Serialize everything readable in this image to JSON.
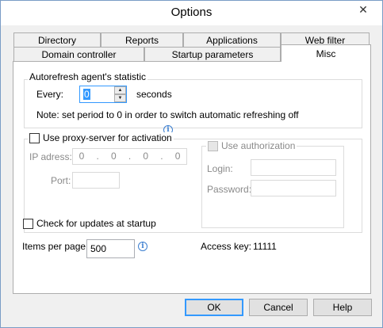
{
  "window": {
    "title": "Options",
    "close_glyph": "✕"
  },
  "tabs": {
    "row_top": [
      "Directory",
      "Reports",
      "Applications",
      "Web filter"
    ],
    "row_bottom": [
      "Domain controller",
      "Startup parameters",
      "Misc"
    ],
    "active": "Misc"
  },
  "autorefresh": {
    "legend": "Autorefresh agent's statistic",
    "every_label": "Every:",
    "value": "0",
    "unit": "seconds",
    "note": "Note: set period to 0 in order to switch automatic refreshing off"
  },
  "proxy": {
    "checkbox_label": "Use proxy-server for activation",
    "ip_label": "IP adress:",
    "ip_octets": [
      "0",
      "0",
      "0",
      "0"
    ],
    "port_label": "Port:",
    "port_value": "",
    "auth_label": "Use authorization",
    "login_label": "Login:",
    "login_value": "",
    "password_label": "Password:",
    "password_value": ""
  },
  "updates": {
    "checkbox_label": "Check for updates at startup"
  },
  "paging": {
    "items_label": "Items per page:",
    "items_value": "500",
    "access_key_label": "Access key:",
    "access_key_value": "11111"
  },
  "buttons": {
    "ok": "OK",
    "cancel": "Cancel",
    "help": "Help"
  },
  "icons": {
    "info": "i",
    "spin_up": "▲",
    "spin_down": "▼"
  }
}
